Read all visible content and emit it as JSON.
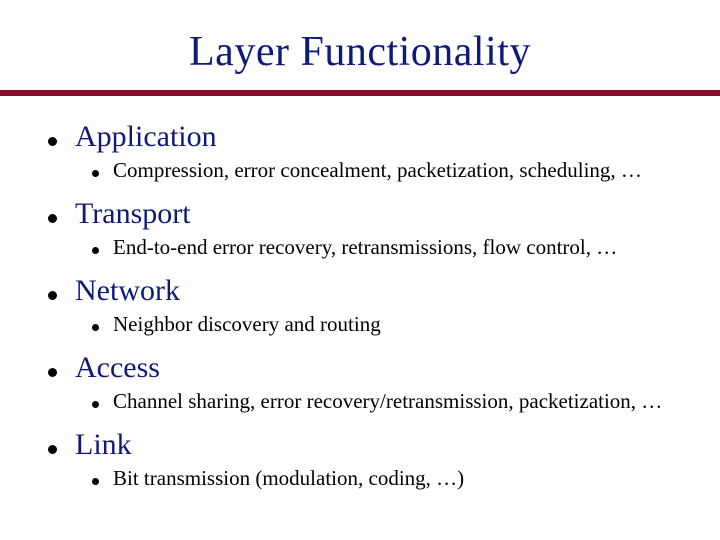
{
  "title": "Layer Functionality",
  "layers": [
    {
      "name": "Application",
      "desc": "Compression, error concealment, packetization, scheduling, …"
    },
    {
      "name": "Transport",
      "desc": "End-to-end error recovery, retransmissions, flow control, …"
    },
    {
      "name": "Network",
      "desc": "Neighbor discovery and routing"
    },
    {
      "name": "Access",
      "desc": "Channel sharing, error recovery/retransmission, packetization, …"
    },
    {
      "name": "Link",
      "desc": "Bit transmission (modulation, coding, …)"
    }
  ]
}
